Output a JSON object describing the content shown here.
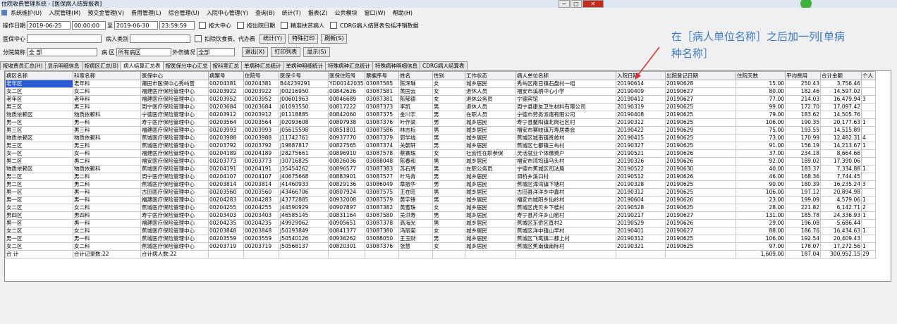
{
  "window": {
    "title": "住院收费管理系统 - [医保病人结算报表]",
    "min": "─",
    "max": "□",
    "close": "✕"
  },
  "menu": [
    "系统维护(U)",
    "入院管理(M)",
    "预交金管理(V)",
    "费用管理(L)",
    "综合管理(U)",
    "入院中心管理(Y)",
    "查询(B)",
    "统计(T)",
    "报表(Z)",
    "公共模块",
    "窗口(W)",
    "帮助(H)"
  ],
  "filters": {
    "op_date_label": "操作日期",
    "date_from": "2019-06-25",
    "time_from": "00:00:00",
    "date_to": "2019-06-30",
    "time_to": "23:59:59",
    "cb_dept_center": "按大中心",
    "cb_discharge": "按出院日期",
    "cb_poverty": "精准扶贫病人",
    "cb_cdrg": "CDRG病人结算表包括冲销数据",
    "insurance_center_label": "医保中心",
    "patient_type_label": "病人类别",
    "cb_deduct": "扣除饮食费、代办费",
    "branch_label": "分院简称",
    "branch_value": "全 部",
    "ward_label": "病 区",
    "ward_value": "所有病区",
    "injury_label": "外伤情况",
    "injury_value": "全部"
  },
  "buttons": {
    "stats": "统计(Y)",
    "special_print": "特殊打印",
    "refresh": "刷新(S)",
    "exit": "退出(X)",
    "print_list": "打印列表",
    "show": "显示(S)"
  },
  "tabs": [
    "按收费员汇总(H)",
    "显示明细信息",
    "按病区汇总(B)",
    "病人结算汇总表",
    "按医保分中心汇总",
    "按科室汇总",
    "单病种汇总统计",
    "单病种明细统计",
    "特殊病种汇总统计",
    "特殊病种明细信息",
    "CDRG病人结算表"
  ],
  "active_tab": 3,
  "table": {
    "headers": [
      "病区名称",
      "科室名称",
      "医保中心",
      "病案号",
      "住院号",
      "医保卡号",
      "医保住院号",
      "票据序号",
      "姓名",
      "性别",
      "工作状态",
      "病人单位名称",
      "入院日期",
      "出院登记日期",
      "住院天数",
      "平均费用",
      "合计金额",
      "个人"
    ],
    "rows": [
      [
        "老年区",
        "老年科",
        "莆田市医保中心秀屿营",
        "00204381",
        "00204381",
        "B44239291",
        "YD00142035",
        "03087585",
        "陈泽琳",
        "女",
        "城乡居民",
        "秀屿区南日镇石盘村一组",
        "20190614",
        "20190628",
        "15.00",
        "250.43",
        "3,756.46",
        ""
      ],
      [
        "女二区",
        "女二科",
        "福建医疗保险管理中心",
        "00203922",
        "00203922",
        "J00216950",
        "00842626",
        "03087581",
        "黄国云",
        "女",
        "退休人员",
        "福安市溪柄中心小学",
        "20190409",
        "20190627",
        "80.00",
        "182.46",
        "14,597.02",
        ""
      ],
      [
        "老年区",
        "老年科",
        "福建医疗保险管理中心",
        "00203952",
        "00203952",
        "J00601963",
        "00846689",
        "03087381",
        "陈郁德",
        "女",
        "退休公务员",
        "宁德宾馆",
        "20190412",
        "20190627",
        "77.00",
        "214.03",
        "16,479.94",
        "3"
      ],
      [
        "男三区",
        "男三科",
        "周宁医疗保险管理中心",
        "00203684",
        "00203684",
        "J01093550",
        "00817222",
        "03087373",
        "李凯",
        "男",
        "退休人员",
        "周宁县康友卫生材料有限公司",
        "20190319",
        "20190625",
        "99.00",
        "172.70",
        "17,097.42",
        ""
      ],
      [
        "物质依赖区",
        "物质依赖科",
        "宁德医疗保险管理中心",
        "00203912",
        "00203912",
        "J01118885",
        "00842060",
        "03087375",
        "金川宇",
        "男",
        "在职人员",
        "宁德市劳务派遣有限公司",
        "20190408",
        "20190625",
        "79.00",
        "183.62",
        "14,505.76",
        ""
      ],
      [
        "男一区",
        "男一科",
        "寿宁医疗保险管理中心",
        "00203564",
        "00203564",
        "J02093608",
        "00807938",
        "03087376",
        "叶作梁",
        "男",
        "城乡居民",
        "寿宁县鳌阳镇北岗社区村",
        "20190312",
        "20190625",
        "106.00",
        "190.35",
        "20,177.63",
        "1"
      ],
      [
        "男三区",
        "男三科",
        "福建医疗保险管理中心",
        "00203993",
        "00203993",
        "J05615598",
        "00851801",
        "03087586",
        "林志标",
        "男",
        "城乡居民",
        "福安市赛岐镇万寿居委会",
        "20190422",
        "20190629",
        "75.00",
        "193.55",
        "14,515.89",
        ""
      ],
      [
        "物质依赖区",
        "物质依赖科",
        "蕉城医疗保险管理中心",
        "00203988",
        "00203988",
        "J11742761",
        "00937770",
        "03087379",
        "郭学线",
        "男",
        "城乡居民",
        "蕉城区城南镇贵岐村",
        "20190415",
        "20190625",
        "73.00",
        "170.99",
        "12,482.31",
        "4"
      ],
      [
        "男三区",
        "男三科",
        "蕉城医疗保险管理中心",
        "00203792",
        "00203792",
        "J19887817",
        "00827565",
        "03087374",
        "关朝轩",
        "男",
        "城乡居民",
        "蕉城区七都镇三屿村",
        "20190327",
        "20190625",
        "91.00",
        "156.19",
        "14,213.67",
        "1"
      ],
      [
        "女一区",
        "女一科",
        "福建医疗保险管理中心",
        "00204189",
        "00204189",
        "J28275661",
        "00896910",
        "03087578",
        "蔡赛珠",
        "女",
        "社会性在职参保",
        "灵活就业个体缴费户",
        "20190521",
        "20190626",
        "37.00",
        "234.18",
        "8,664.66",
        ""
      ],
      [
        "男二区",
        "男二科",
        "福安医疗保险管理中心",
        "00203773",
        "00203773",
        "J30716825",
        "00826036",
        "03088048",
        "陈春和",
        "男",
        "城乡居民",
        "福安市湾坞镇马头村",
        "20190326",
        "20190626",
        "92.00",
        "189.02",
        "17,390.06",
        ""
      ],
      [
        "物质依赖区",
        "物质依赖科",
        "蕉城医疗保险管理中心",
        "00204191",
        "00204191",
        "J35454262",
        "00896577",
        "03087383",
        "苏石辉",
        "男",
        "在职公务员",
        "宁德市蕉城区司法局",
        "20190522",
        "20190630",
        "40.00",
        "183.37",
        "7,334.88",
        "1"
      ],
      [
        "男二区",
        "男二科",
        "周宁医疗保险管理中心",
        "00204107",
        "00204107",
        "J40675668",
        "00883901",
        "03087577",
        "叶马青",
        "男",
        "城乡居民",
        "泗桥乡溪口村",
        "20190512",
        "20190626",
        "46.00",
        "168.36",
        "7,744.45",
        ""
      ],
      [
        "男二区",
        "男二科",
        "蕉城医疗保险管理中心",
        "00203814",
        "00203814",
        "J41460933",
        "00829136",
        "03086049",
        "章振华",
        "男",
        "城乡居民",
        "蕉城区漳湾镇下塘村",
        "20190328",
        "20190625",
        "90.00",
        "180.39",
        "16,235.24",
        "3"
      ],
      [
        "男一区",
        "男一科",
        "古田医疗保险管理中心",
        "00203560",
        "00203560",
        "J43466706",
        "00807924",
        "03087575",
        "王在旺",
        "男",
        "城乡居民",
        "古田县洋洋乡中鑫村",
        "20190312",
        "20190625",
        "106.00",
        "197.12",
        "20,894.98",
        ""
      ],
      [
        "男一区",
        "男一科",
        "福建医疗保险管理中心",
        "00204283",
        "00204283",
        "J43772885",
        "00932008",
        "03087579",
        "黄宇锋",
        "男",
        "城乡居民",
        "福安市城阳乡仙岭村",
        "20190604",
        "20190626",
        "23.00",
        "199.09",
        "4,579.06",
        "1"
      ],
      [
        "女二区",
        "女二科",
        "蕉城医疗保险管理中心",
        "00204255",
        "00204255",
        "J44590929",
        "00907897",
        "03087382",
        "黄蜜珠",
        "女",
        "城乡居民",
        "蕉城区虎贝乡下楼村",
        "20190528",
        "20190625",
        "28.00",
        "221.82",
        "6,142.71",
        "2"
      ],
      [
        "男四区",
        "男四科",
        "寿宁医疗保险管理中心",
        "00203403",
        "00203403",
        "J46585145",
        "00831164",
        "03087580",
        "吴洪寿",
        "男",
        "城乡居民",
        "寿宁县芹洋乡山窑村",
        "20190217",
        "20190627",
        "131.00",
        "185.78",
        "24,336.93",
        "1"
      ],
      [
        "男一区",
        "男一科",
        "福建医疗保险管理中心",
        "00204235",
        "00204235",
        "J49929062",
        "00905651",
        "03087378",
        "高海光",
        "男",
        "城乡居民",
        "蕉城区东侨区直村2",
        "20190529",
        "20190626",
        "29.00",
        "196.08",
        "5,686.44",
        ""
      ],
      [
        "女二区",
        "女二科",
        "蕉城医疗保险管理中心",
        "00203848",
        "00203848",
        "J50193849",
        "00841377",
        "03087380",
        "冯丽菊",
        "女",
        "城乡居民",
        "蕉城区洋中镇山早村",
        "20190401",
        "20190627",
        "88.00",
        "186.76",
        "16,434.63",
        "1"
      ],
      [
        "男一区",
        "男一科",
        "蕉城医疗保险管理中心",
        "00203559",
        "00203559",
        "J50540126",
        "00936262",
        "03088050",
        "王玉财",
        "男",
        "城乡居民",
        "蕉城区飞鸾镇二都上村",
        "20190312",
        "20190625",
        "106.00",
        "192.54",
        "20,409.43",
        ""
      ],
      [
        "女二区",
        "女二科",
        "蕉城医疗保险管理中心",
        "00203719",
        "00203719",
        "J50568137",
        "00820301",
        "03087376",
        "张慧",
        "女",
        "城乡居民",
        "蕉城区蕉南镇南际村",
        "20190321",
        "20190625",
        "97.00",
        "178.07",
        "17,272.56",
        "1"
      ]
    ],
    "total": {
      "c1": "合 计",
      "c2": "合计记录数:22",
      "c3": "合计病人数:22",
      "days": "1,609.00",
      "avg": "187.04",
      "sum": "300,952.15",
      "p": "29"
    }
  },
  "annotation": {
    "line1": "在［病人单位名称］之后加一列[单病",
    "line2": "种名称］",
    "color": "#3a78c8"
  }
}
